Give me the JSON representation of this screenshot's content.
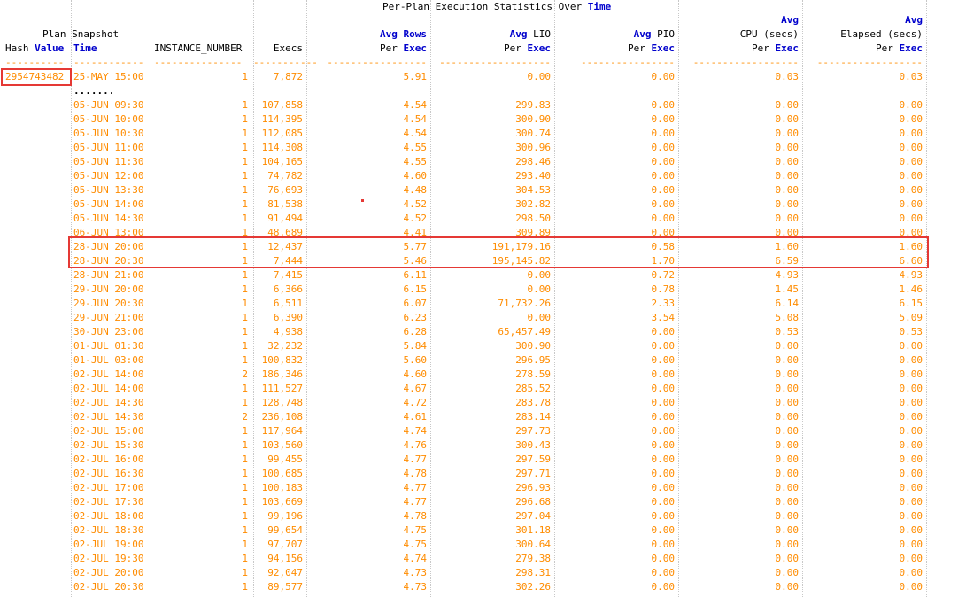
{
  "report": {
    "title_prefix": "Per-Plan Execution Statistics Over ",
    "title_keyword": "Time"
  },
  "headers": {
    "row1": {
      "cpu": "Avg",
      "elapsed": "Avg"
    },
    "row2": {
      "plan_snapshot": "Plan Snapshot",
      "rows_avg": "Avg",
      "rows_rows": "Rows",
      "lio_avg": "Avg",
      "lio_lio": "LIO",
      "pio_avg": "Avg",
      "pio_pio": "PIO",
      "cpu": "CPU (secs)",
      "elapsed": "Elapsed (secs)"
    },
    "row3": {
      "hash": "Hash",
      "value": "Value",
      "time": "Time",
      "instance": "INSTANCE_NUMBER",
      "execs": "Execs",
      "per": "Per",
      "exec": "Exec"
    },
    "underline": {
      "hash": "----------",
      "time": "------------",
      "instance": "---------------",
      "execs": "-----------",
      "rows": "-----------------",
      "lio": "-------------------",
      "pio": "----------------",
      "cpu": "------------------",
      "elapsed": "------------------"
    }
  },
  "first_entry": {
    "hash_value": "2954743482",
    "time": "25-MAY 15:00",
    "instance": "1",
    "execs": "7,872",
    "rows": "5.91",
    "lio": "0.00",
    "pio": "0.00",
    "cpu": "0.03",
    "elapsed": "0.03"
  },
  "ellipsis": ".......",
  "rows": [
    [
      "05-JUN 09:30",
      "1",
      "107,858",
      "4.54",
      "299.83",
      "0.00",
      "0.00",
      "0.00"
    ],
    [
      "05-JUN 10:00",
      "1",
      "114,395",
      "4.54",
      "300.90",
      "0.00",
      "0.00",
      "0.00"
    ],
    [
      "05-JUN 10:30",
      "1",
      "112,085",
      "4.54",
      "300.74",
      "0.00",
      "0.00",
      "0.00"
    ],
    [
      "05-JUN 11:00",
      "1",
      "114,308",
      "4.55",
      "300.96",
      "0.00",
      "0.00",
      "0.00"
    ],
    [
      "05-JUN 11:30",
      "1",
      "104,165",
      "4.55",
      "298.46",
      "0.00",
      "0.00",
      "0.00"
    ],
    [
      "05-JUN 12:00",
      "1",
      "74,782",
      "4.60",
      "293.40",
      "0.00",
      "0.00",
      "0.00"
    ],
    [
      "05-JUN 13:30",
      "1",
      "76,693",
      "4.48",
      "304.53",
      "0.00",
      "0.00",
      "0.00"
    ],
    [
      "05-JUN 14:00",
      "1",
      "81,538",
      "4.52",
      "302.82",
      "0.00",
      "0.00",
      "0.00"
    ],
    [
      "05-JUN 14:30",
      "1",
      "91,494",
      "4.52",
      "298.50",
      "0.00",
      "0.00",
      "0.00"
    ],
    [
      "06-JUN 13:00",
      "1",
      "48,689",
      "4.41",
      "309.89",
      "0.00",
      "0.00",
      "0.00"
    ],
    [
      "28-JUN 20:00",
      "1",
      "12,437",
      "5.77",
      "191,179.16",
      "0.58",
      "1.60",
      "1.60"
    ],
    [
      "28-JUN 20:30",
      "1",
      "7,444",
      "5.46",
      "195,145.82",
      "1.70",
      "6.59",
      "6.60"
    ],
    [
      "28-JUN 21:00",
      "1",
      "7,415",
      "6.11",
      "0.00",
      "0.72",
      "4.93",
      "4.93"
    ],
    [
      "29-JUN 20:00",
      "1",
      "6,366",
      "6.15",
      "0.00",
      "0.78",
      "1.45",
      "1.46"
    ],
    [
      "29-JUN 20:30",
      "1",
      "6,511",
      "6.07",
      "71,732.26",
      "2.33",
      "6.14",
      "6.15"
    ],
    [
      "29-JUN 21:00",
      "1",
      "6,390",
      "6.23",
      "0.00",
      "3.54",
      "5.08",
      "5.09"
    ],
    [
      "30-JUN 23:00",
      "1",
      "4,938",
      "6.28",
      "65,457.49",
      "0.00",
      "0.53",
      "0.53"
    ],
    [
      "01-JUL 01:30",
      "1",
      "32,232",
      "5.84",
      "300.90",
      "0.00",
      "0.00",
      "0.00"
    ],
    [
      "01-JUL 03:00",
      "1",
      "100,832",
      "5.60",
      "296.95",
      "0.00",
      "0.00",
      "0.00"
    ],
    [
      "02-JUL 14:00",
      "2",
      "186,346",
      "4.60",
      "278.59",
      "0.00",
      "0.00",
      "0.00"
    ],
    [
      "02-JUL 14:00",
      "1",
      "111,527",
      "4.67",
      "285.52",
      "0.00",
      "0.00",
      "0.00"
    ],
    [
      "02-JUL 14:30",
      "1",
      "128,748",
      "4.72",
      "283.78",
      "0.00",
      "0.00",
      "0.00"
    ],
    [
      "02-JUL 14:30",
      "2",
      "236,108",
      "4.61",
      "283.14",
      "0.00",
      "0.00",
      "0.00"
    ],
    [
      "02-JUL 15:00",
      "1",
      "117,964",
      "4.74",
      "297.73",
      "0.00",
      "0.00",
      "0.00"
    ],
    [
      "02-JUL 15:30",
      "1",
      "103,560",
      "4.76",
      "300.43",
      "0.00",
      "0.00",
      "0.00"
    ],
    [
      "02-JUL 16:00",
      "1",
      "99,455",
      "4.77",
      "297.59",
      "0.00",
      "0.00",
      "0.00"
    ],
    [
      "02-JUL 16:30",
      "1",
      "100,685",
      "4.78",
      "297.71",
      "0.00",
      "0.00",
      "0.00"
    ],
    [
      "02-JUL 17:00",
      "1",
      "100,183",
      "4.77",
      "296.93",
      "0.00",
      "0.00",
      "0.00"
    ],
    [
      "02-JUL 17:30",
      "1",
      "103,669",
      "4.77",
      "296.68",
      "0.00",
      "0.00",
      "0.00"
    ],
    [
      "02-JUL 18:00",
      "1",
      "99,196",
      "4.78",
      "297.04",
      "0.00",
      "0.00",
      "0.00"
    ],
    [
      "02-JUL 18:30",
      "1",
      "99,654",
      "4.75",
      "301.18",
      "0.00",
      "0.00",
      "0.00"
    ],
    [
      "02-JUL 19:00",
      "1",
      "97,707",
      "4.75",
      "300.64",
      "0.00",
      "0.00",
      "0.00"
    ],
    [
      "02-JUL 19:30",
      "1",
      "94,156",
      "4.74",
      "279.38",
      "0.00",
      "0.00",
      "0.00"
    ],
    [
      "02-JUL 20:00",
      "1",
      "92,047",
      "4.73",
      "298.31",
      "0.00",
      "0.00",
      "0.00"
    ],
    [
      "02-JUL 20:30",
      "1",
      "89,577",
      "4.73",
      "302.26",
      "0.00",
      "0.00",
      "0.00"
    ]
  ],
  "colors": {
    "value": "#ff8c00",
    "keyword": "#0000cc",
    "highlight": "#e53935"
  }
}
